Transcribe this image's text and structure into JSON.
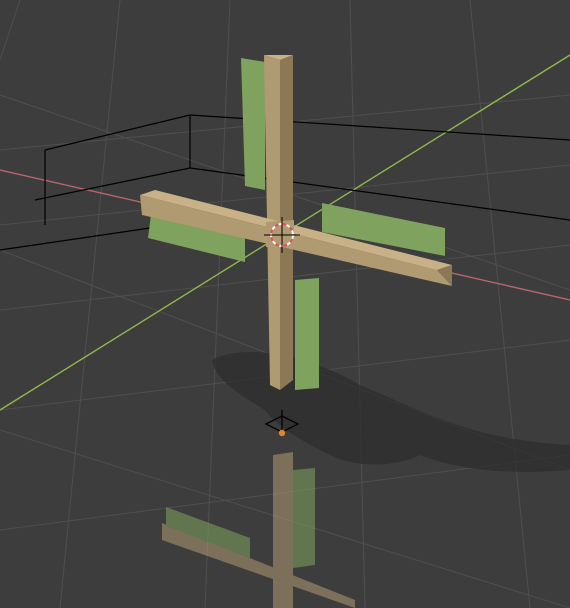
{
  "viewport": {
    "view_type": "3D viewport",
    "shading": "solid",
    "background_color": "#3d3d3d",
    "grid_line_color": "#4f4f4f",
    "x_axis_color": "#b8666f",
    "y_axis_color": "#8eb84a",
    "floor_reflection": true
  },
  "scene": {
    "object": {
      "shape": "windmill cross",
      "beam_color": "#b09a72",
      "beam_shade_color": "#8c7855",
      "blade_color": "#7fa35f",
      "blade_shade_color": "#6a8a50",
      "shadow_color": "#2e2e2e"
    },
    "box_outline_color": "#000000",
    "cursor": {
      "icon": "3d-cursor-icon",
      "ring_color_a": "#e05050",
      "ring_color_b": "#ffffff"
    },
    "origin_marker": {
      "icon": "object-origin-icon",
      "dot_color": "#e0872d"
    }
  }
}
